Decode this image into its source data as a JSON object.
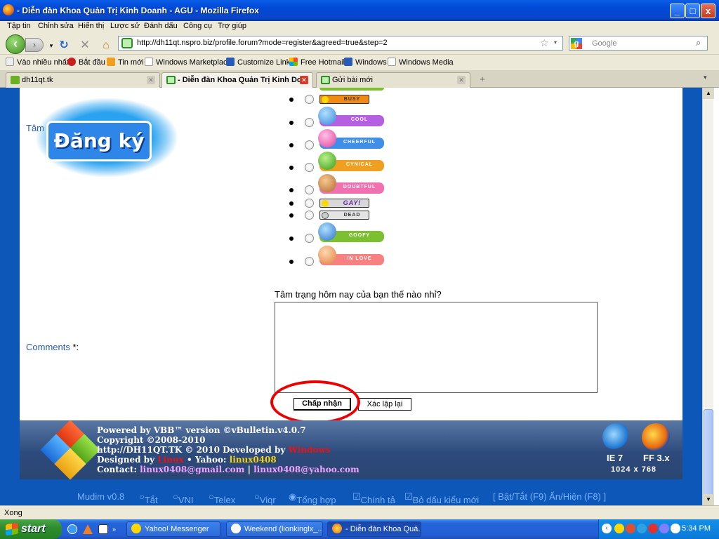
{
  "window": {
    "title": "- Diễn đàn Khoa Quản Trị Kinh Doanh - AGU - Mozilla Firefox",
    "buttons": [
      "_",
      "□",
      "x"
    ]
  },
  "menubar": [
    "Tập tin",
    "Chỉnh sửa",
    "Hiển thị",
    "Lược sử",
    "Đánh dấu",
    "Công cụ",
    "Trợ giúp"
  ],
  "nav": {
    "back_icon": "back-arrow-icon",
    "forward_icon": "forward-arrow-icon",
    "url": "http://dh11qt.nspro.biz/profile.forum?mode=register&agreed=true&step=2",
    "search_placeholder": "Google"
  },
  "bookmarks": [
    "Vào nhiều nhất",
    "Bắt đầu",
    "Tin mới",
    "Windows Marketplace",
    "Customize Links",
    "Free Hotmail",
    "Windows",
    "Windows Media"
  ],
  "tabs": [
    {
      "label": "dh11qt.tk",
      "active": false
    },
    {
      "label": "- Diễn đàn Khoa Quản Trị Kinh Do...",
      "active": true
    },
    {
      "label": "Gửi bài mới",
      "active": false
    }
  ],
  "logo": {
    "text": "Đăng ký"
  },
  "labels": {
    "mood_partial": "Tâm",
    "comments": "Comments",
    "required_marker": "*:",
    "question": "Tâm trạng hôm nay của bạn thế nào nhỉ?"
  },
  "moods": [
    {
      "text": "BUSY",
      "color": "#f08a14"
    },
    {
      "text": "COOL",
      "color": "#b560e0"
    },
    {
      "text": "CHEERFUL",
      "color": "#3f8ee8"
    },
    {
      "text": "CYNICAL",
      "color": "#f0a020"
    },
    {
      "text": "DOUBTFUL",
      "color": "#f070b0"
    },
    {
      "text": "GAY!",
      "color": "#b0b0b0"
    },
    {
      "text": "DEAD",
      "color": "#d0d0d0"
    },
    {
      "text": "GOOFY",
      "color": "#7cc030"
    },
    {
      "text": "IN LOVE",
      "color": "#f78080"
    }
  ],
  "buttons": {
    "submit": "Chấp nhận",
    "reset": "Xác lập lại"
  },
  "footer": {
    "line1_a": "Powered by VBB™ version ©vBulletin.v4.0.7",
    "line2": "Copyright ©2008-2010",
    "line3_a": "http://DH11QT.TK © 2010 Developed by",
    "line3_b": "Windows",
    "line4_a": "Designed by",
    "line4_b": "Linux",
    "line4_c": "• Yahoo:",
    "line4_d": "linux0408",
    "line5_a": "Contact:",
    "line5_b": "linux0408@gmail.com",
    "line5_c": "|",
    "line5_d": "linux0408@yahoo.com",
    "ie_label": "IE 7",
    "ff_label": "FF 3.x",
    "resolution": "1024 x 768"
  },
  "mudim": {
    "title": "Mudim v0.8",
    "opts": [
      "Tắt",
      "VNI",
      "Telex",
      "Viqr",
      "Tổng hợp"
    ],
    "check1": "Chính tả",
    "check2": "Bỏ dấu kiểu mới",
    "links": "[ Bật/Tắt (F9) Ẩn/Hiện (F8) ]"
  },
  "status": "Xong",
  "taskbar": {
    "start": "start",
    "items": [
      "Yahoo! Messenger",
      "Weekend (lionkinglx_...",
      "- Diễn đàn Khoa Quả..."
    ],
    "clock": "5:34 PM"
  }
}
